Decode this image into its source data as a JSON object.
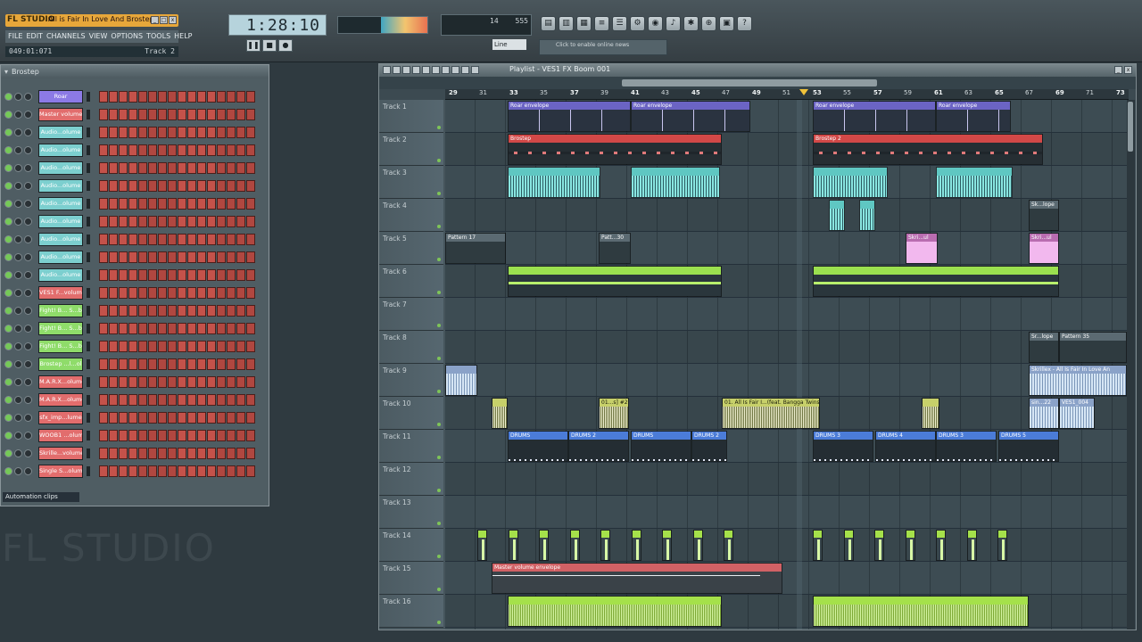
{
  "app": {
    "logo": "FL STUDIO",
    "song_title": "All is Fair In Love And Brostep R...",
    "window_controls": [
      "_",
      "□",
      "x"
    ],
    "menu": [
      "FILE",
      "EDIT",
      "CHANNELS",
      "VIEW",
      "OPTIONS",
      "TOOLS",
      "HELP"
    ],
    "position": "049:01:071",
    "current_track": "Track 2",
    "time_display": "1:28:10",
    "cpu_label": "14",
    "cpu_value": "555",
    "snap": "Line",
    "hint": "Click to enable online news",
    "background_brand": "FL STUDIO"
  },
  "step_sequencer": {
    "pattern": "Brostep",
    "channels": [
      {
        "name": "Roar",
        "color": "#8c7ae6"
      },
      {
        "name": "Master volume",
        "color": "#e26d6d"
      },
      {
        "name": "Audio...olume",
        "color": "#7ccfcf"
      },
      {
        "name": "Audio...olume",
        "color": "#7ccfcf"
      },
      {
        "name": "Audio...olume",
        "color": "#7ccfcf"
      },
      {
        "name": "Audio...olume",
        "color": "#7ccfcf"
      },
      {
        "name": "Audio...olume",
        "color": "#7ccfcf"
      },
      {
        "name": "Audio...olume",
        "color": "#7ccfcf"
      },
      {
        "name": "Audio...olume",
        "color": "#7ccfcf"
      },
      {
        "name": "Audio...olume",
        "color": "#7ccfcf"
      },
      {
        "name": "Audio...olume",
        "color": "#7ccfcf"
      },
      {
        "name": "VES1 F...volume",
        "color": "#e26d6d"
      },
      {
        "name": "Fight! B... S...b",
        "color": "#8fdc6a"
      },
      {
        "name": "Fight! B... S...b",
        "color": "#8fdc6a"
      },
      {
        "name": "Fight! B... S...b",
        "color": "#8fdc6a"
      },
      {
        "name": "Brostep ...l...ol",
        "color": "#8fdc6a"
      },
      {
        "name": "M.A.R.X...olume",
        "color": "#e26d6d"
      },
      {
        "name": "M.A.R.X...olume",
        "color": "#e26d6d"
      },
      {
        "name": "sfx_imp...lume",
        "color": "#e26d6d"
      },
      {
        "name": "WOOB1 ...olume",
        "color": "#e26d6d"
      },
      {
        "name": "Skrille...volume",
        "color": "#e26d6d"
      },
      {
        "name": "Single S...olume",
        "color": "#e26d6d"
      }
    ],
    "footer": "Automation clips"
  },
  "playlist": {
    "title": "Playlist - VES1 FX Boom 001",
    "ruler_start": 29,
    "ruler_step": 2,
    "ruler_count": 24,
    "tracks": [
      "Track 1",
      "Track 2",
      "Track 3",
      "Track 4",
      "Track 5",
      "Track 6",
      "Track 7",
      "Track 8",
      "Track 9",
      "Track 10",
      "Track 11",
      "Track 12",
      "Track 13",
      "Track 14",
      "Track 15",
      "Track 16"
    ],
    "clip_labels": {
      "roar": "Roar envelope",
      "brostep": "Brostep",
      "brostep2": "Brostep 2",
      "pattern17": "Pattern 17",
      "patt30": "Patt...30",
      "skriul": "Skri...ul",
      "sklope": "Sk...lope",
      "srlope": "Sr...lope",
      "pattern35": "Pattern 35",
      "skrillex": "Skrillex - All Is Fair In Love An",
      "dn01": "01...s] #2",
      "allfair": "01. All Is Fair I...(feat. Bangga Twins)",
      "drums": "DRUMS",
      "drums2": "DRUMS 2",
      "drums3": "DRUMS 3",
      "drums4": "DRUMS 4",
      "drums5": "DRUMS 5",
      "master": "Master volume envelope",
      "sin22": "sin...22",
      "ves1": "VES1_004"
    }
  }
}
